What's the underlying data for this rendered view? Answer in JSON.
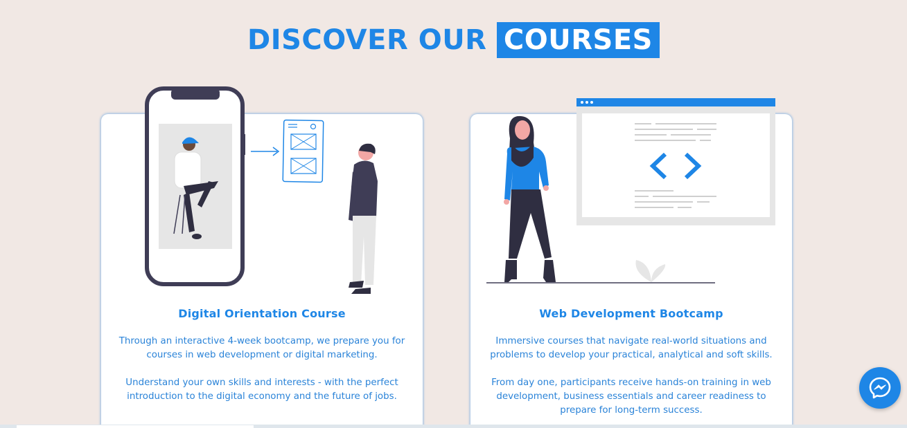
{
  "section": {
    "title_part1": "DISCOVER OUR ",
    "title_highlight": "COURSES"
  },
  "courses": [
    {
      "title": "Digital Orientation Course",
      "paragraph1": "Through an interactive 4-week bootcamp, we prepare you for courses in web development or digital marketing.",
      "paragraph2": "Understand your own skills and interests - with the perfect introduction to the digital economy and the future of jobs.",
      "illustration": "mobile-wireframe-illustration"
    },
    {
      "title": "Web Development Bootcamp",
      "paragraph1": "Immersive courses that navigate real-world situations and problems to develop your practical, analytical and soft skills.",
      "paragraph2": "From day one, participants receive hands-on training in web development, business essentials and career readiness to prepare for long-term success.",
      "illustration": "code-window-illustration"
    }
  ],
  "chat_widget": {
    "icon": "messenger-icon"
  },
  "colors": {
    "accent": "#1e86e6",
    "background": "#f1e8e4",
    "dark_figure": "#3f3d56"
  }
}
